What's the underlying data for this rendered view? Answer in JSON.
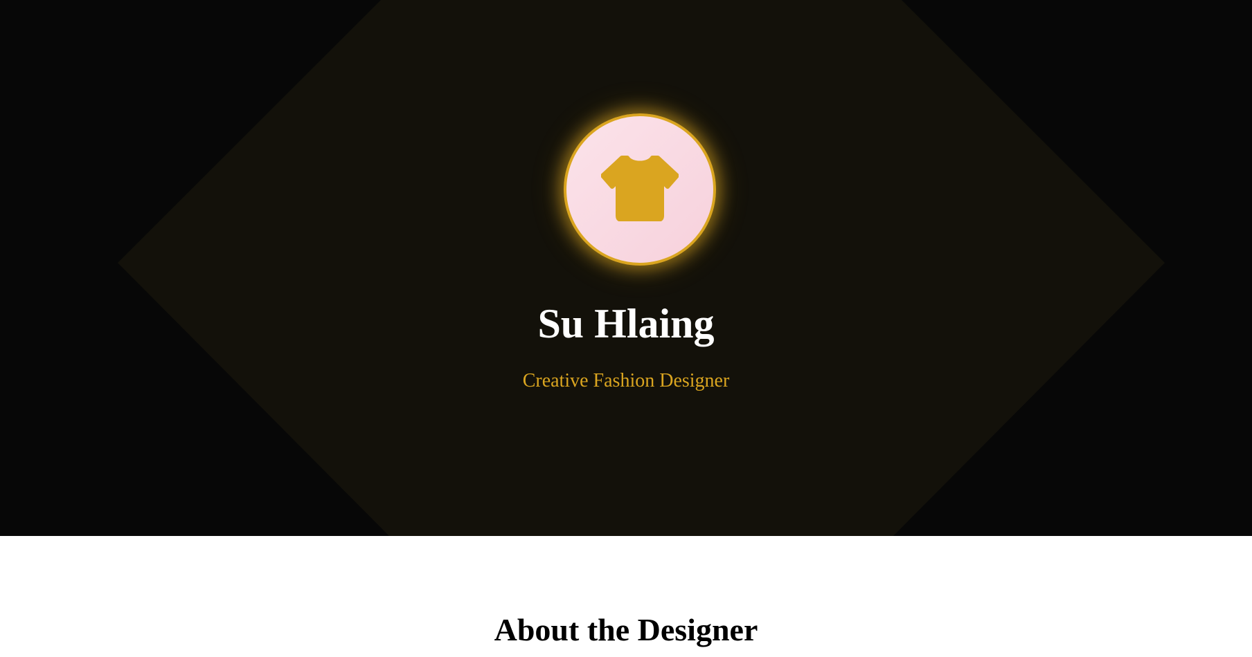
{
  "colors": {
    "hero_background": "#070707",
    "hero_diamond": "#13110a",
    "accent_gold": "#DAA520",
    "avatar_pink": "#f9d7e0",
    "name_text": "#ffffff",
    "section_title_text": "#000000"
  },
  "hero": {
    "avatar_icon": "tshirt-icon",
    "name": "Su Hlaing",
    "role": "Creative Fashion Designer"
  },
  "about": {
    "title": "About the Designer"
  }
}
